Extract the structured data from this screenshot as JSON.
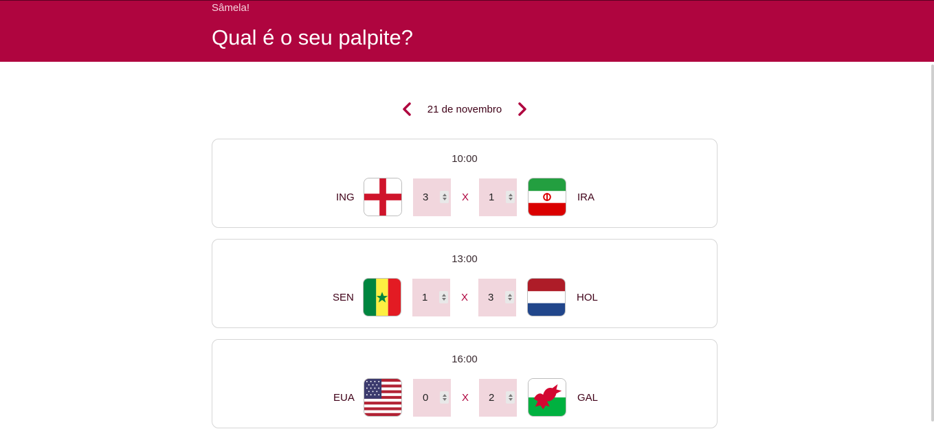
{
  "header": {
    "greeting": "Sâmela!",
    "title": "Qual é o seu palpite?"
  },
  "date_nav": {
    "date": "21 de novembro",
    "prev_icon": "chevron-left-icon",
    "next_icon": "chevron-right-icon"
  },
  "colors": {
    "brand": "#af053f",
    "score_bg": "#f1d6dd"
  },
  "matches": [
    {
      "time": "10:00",
      "home": "ING",
      "home_score": "3",
      "separator": "X",
      "away_score": "1",
      "away": "IRA",
      "home_flag": "england-flag-icon",
      "away_flag": "iran-flag-icon"
    },
    {
      "time": "13:00",
      "home": "SEN",
      "home_score": "1",
      "separator": "X",
      "away_score": "3",
      "away": "HOL",
      "home_flag": "senegal-flag-icon",
      "away_flag": "netherlands-flag-icon"
    },
    {
      "time": "16:00",
      "home": "EUA",
      "home_score": "0",
      "separator": "X",
      "away_score": "2",
      "away": "GAL",
      "home_flag": "usa-flag-icon",
      "away_flag": "wales-flag-icon"
    }
  ]
}
